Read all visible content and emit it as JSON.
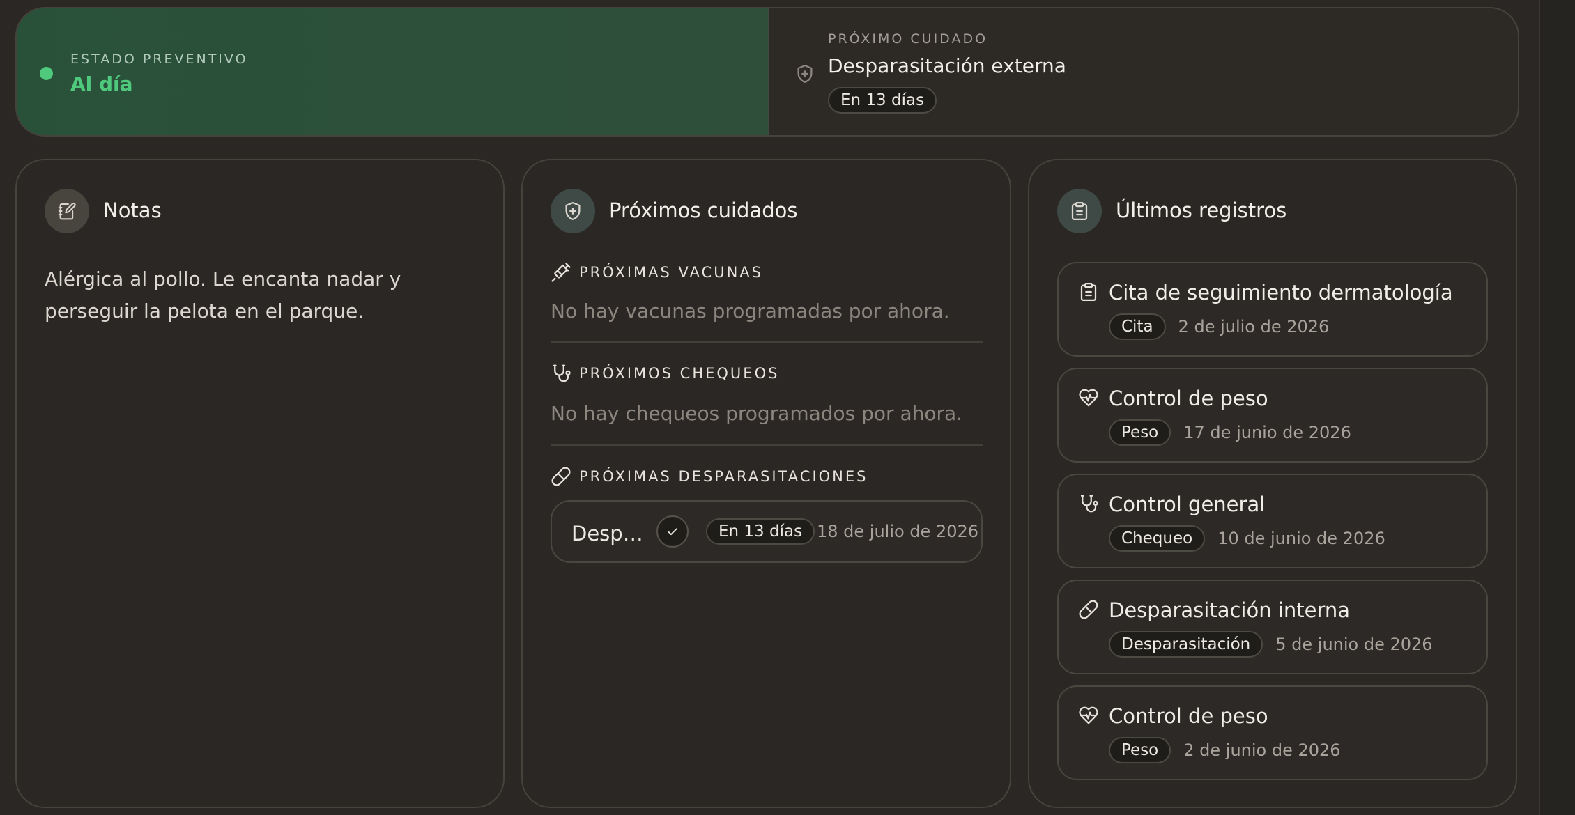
{
  "status": {
    "eyebrow": "ESTADO PREVENTIVO",
    "value": "Al día",
    "color": "#4fca7d"
  },
  "next_care": {
    "eyebrow": "PRÓXIMO CUIDADO",
    "title": "Desparasitación externa",
    "badge": "En 13 días",
    "icon": "shield-plus-icon"
  },
  "notes": {
    "title": "Notas",
    "icon": "notebook-pen-icon",
    "text": "Alérgica al pollo. Le encanta nadar y perseguir la pelota en el parque."
  },
  "upcoming": {
    "title": "Próximos cuidados",
    "icon": "shield-plus-icon",
    "vaccines": {
      "label": "PRÓXIMAS VACUNAS",
      "icon": "syringe-icon",
      "empty": "No hay vacunas programadas por ahora."
    },
    "checkups": {
      "label": "PRÓXIMOS CHEQUEOS",
      "icon": "stethoscope-icon",
      "empty": "No hay chequeos programados por ahora."
    },
    "deworming": {
      "label": "PRÓXIMAS DESPARASITACIONES",
      "icon": "pill-icon",
      "items": [
        {
          "name": "Desp…",
          "badge": "En 13 días",
          "date": "18 de julio de 2026"
        }
      ]
    }
  },
  "records": {
    "title": "Últimos registros",
    "icon": "clipboard-icon",
    "items": [
      {
        "icon": "clipboard-icon",
        "title": "Cita de seguimiento dermatología",
        "tag": "Cita",
        "date": "2 de julio de 2026"
      },
      {
        "icon": "heart-pulse-icon",
        "title": "Control de peso",
        "tag": "Peso",
        "date": "17 de junio de 2026"
      },
      {
        "icon": "stethoscope-icon",
        "title": "Control general",
        "tag": "Chequeo",
        "date": "10 de junio de 2026"
      },
      {
        "icon": "pill-icon",
        "title": "Desparasitación interna",
        "tag": "Desparasitación",
        "date": "5 de junio de 2026"
      },
      {
        "icon": "heart-pulse-icon",
        "title": "Control de peso",
        "tag": "Peso",
        "date": "2 de junio de 2026"
      }
    ]
  }
}
